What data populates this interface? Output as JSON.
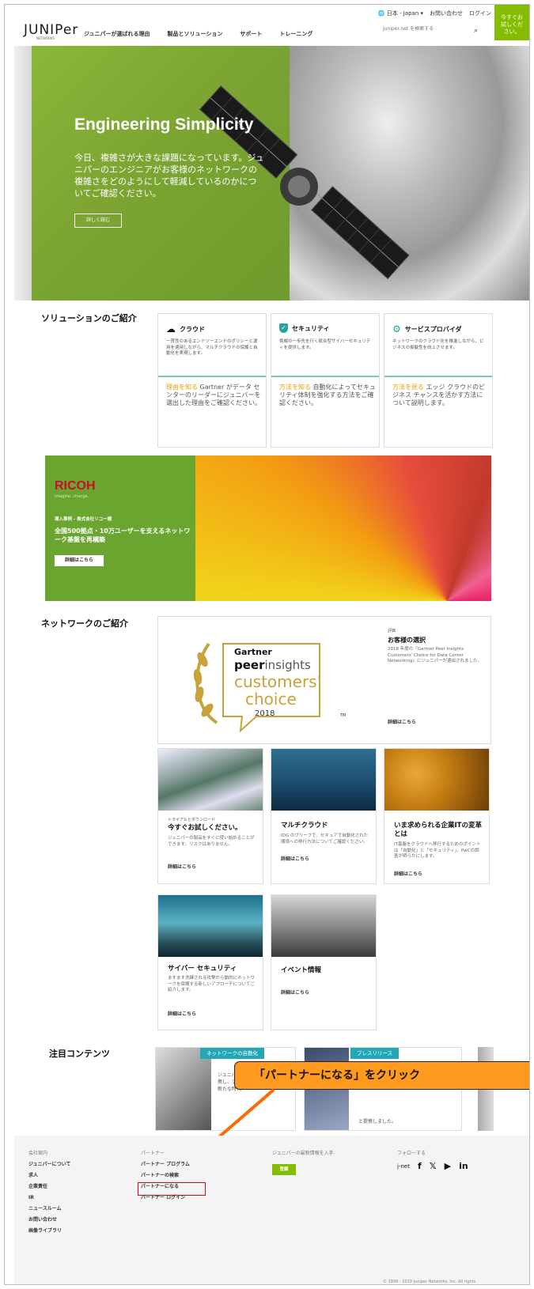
{
  "header": {
    "locale": "日本 - Japan",
    "contact": "お問い合わせ",
    "login": "ログイン",
    "try_now": [
      "今すぐお",
      "試しくだ",
      "さい。"
    ],
    "logo_text": "JUNIPer",
    "logo_sub": "NETWORKS",
    "nav": [
      "ジュニパーが選ばれる理由",
      "製品とソリューション",
      "サポート",
      "トレーニング"
    ],
    "search_placeholder": "Juniper.net を検索する"
  },
  "hero": {
    "title": "Engineering Simplicity",
    "body": "今日、複雑さが大きな課題になっています。ジュニパーのエンジニアがお客様のネットワークの複雑さをどのようにして軽減しているのかについてご確認ください。",
    "button": "詳しく読む"
  },
  "solutions": {
    "title": "ソリューションのご紹介",
    "cards": [
      {
        "icon": "cloud-icon",
        "title": "クラウド",
        "desc": "一貫性のあるエンドツーエンドのポリシーと運用を適用しながら、マルチクラウドの保護と自動化を実現します。",
        "link": "理由を知る",
        "more": " Gartner がデータ センターのリーダーにジュニパーを選出した理由をご確認ください。"
      },
      {
        "icon": "shield-check-icon",
        "title": "セキュリティ",
        "desc": "脅威の一歩先を行く統合型サイバーセキュリティを提供します。",
        "link": "方法を知る",
        "more": " 自動化によってセキュリティ体制を強化する方法をご確認ください。"
      },
      {
        "icon": "gear-icon",
        "title": "サービスプロバイダ",
        "desc": "ネットワークのクラウド化を推進しながら、ビジネスの俊敏性を向上させます。",
        "link": "方法を見る",
        "more": " エッジ クラウドのビジネス チャンスを活かす方法について説明します。"
      }
    ]
  },
  "ricoh": {
    "logo": "RICOH",
    "tagline": "imagine. change.",
    "case": "導入事例 - 株式会社リコー様",
    "headline": "全国500拠点・10万ユーザーを支えるネットワーク基盤を再構築",
    "button": "詳細はこちら"
  },
  "network": {
    "title": "ネットワークのご紹介",
    "gartner": {
      "gartner": "Gartner",
      "peer": "peer",
      "insights": "insights",
      "customers": "customers'",
      "choice": "choice",
      "year": "2018",
      "tm": "TM",
      "category": "評価",
      "headline": "お客様の選択",
      "desc": "2018 年度の『Gartner Peer Insights Customers' Choice for Data Center Networking』にジュニパーが選出されました。",
      "link": "詳細はこちら"
    },
    "cards": [
      {
        "category": "トライアルとダウンロード",
        "title": "今すぐお試しください。",
        "desc": "ジュニパーの製品をすぐに使い始めることができます。リスクはありません。",
        "link": "詳細はこちら"
      },
      {
        "category": "",
        "title": "マルチクラウド",
        "desc": "IDG のブリーフで、セキュアで自動化された環境への移行方法についてご確認ください。",
        "link": "詳細はこちら"
      },
      {
        "category": "",
        "title": "いま求められる企業ITの変革とは",
        "desc": "IT基盤をクラウドへ移行するためのポイントは「自動化」と「セキュリティ」。PwCの調査が明らかにします。",
        "link": "詳細はこちら"
      },
      {
        "category": "",
        "title": "サイバー セキュリティ",
        "desc": "ますます洗練される攻撃から動的にネットワークを保護する新しいアプローチについてご紹介します。",
        "link": "詳細はこちら"
      },
      {
        "category": "",
        "title": "イベント情報",
        "desc": "",
        "link": "詳細はこちら"
      }
    ]
  },
  "featured": {
    "title": "注目コンテンツ",
    "badge1": "ネットワークの自動化",
    "badge2": "プレスリリース",
    "text1": "ジュニパー",
    "text1b": "携し、シン",
    "text1c": "新たな時代",
    "text2": "と提携しました。"
  },
  "callout": {
    "text": "「パートナーになる」をクリック"
  },
  "footer": {
    "col1": {
      "heading": "会社案内",
      "items": [
        "ジュニパーについて",
        "求人",
        "企業責任",
        "IR",
        "ニュースルーム",
        "お問い合わせ",
        "画像ライブラリ"
      ]
    },
    "col2": {
      "heading": "パートナー",
      "items": [
        "パートナー プログラム",
        "パートナーの検索",
        "パートナーになる",
        "パートナー ログイン"
      ]
    },
    "col3": {
      "heading": "ジュニパーの最新情報を入手",
      "button": "登録"
    },
    "col4": {
      "heading": "フォローする",
      "jnet": "j-net",
      "social": [
        "f",
        "𝕏",
        "▶",
        "in"
      ]
    },
    "copyright": "© 1999 - 2019 Juniper Networks, Inc. All rights"
  }
}
